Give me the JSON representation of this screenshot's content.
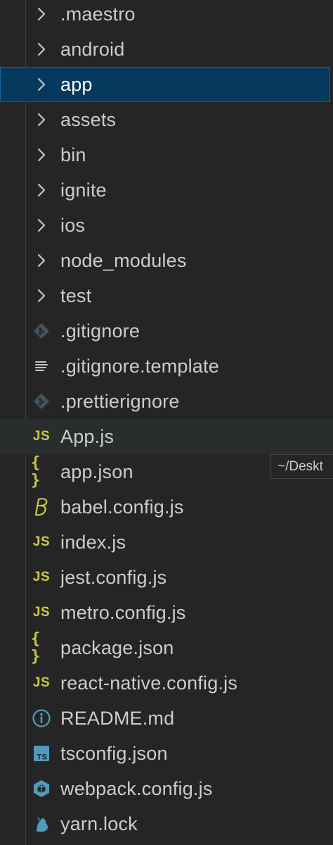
{
  "explorer": {
    "items": [
      {
        "label": ".maestro",
        "kind": "folder",
        "icon": "chevron-right-icon"
      },
      {
        "label": "android",
        "kind": "folder",
        "icon": "chevron-right-icon"
      },
      {
        "label": "app",
        "kind": "folder",
        "icon": "chevron-right-icon",
        "state": "selected"
      },
      {
        "label": "assets",
        "kind": "folder",
        "icon": "chevron-right-icon"
      },
      {
        "label": "bin",
        "kind": "folder",
        "icon": "chevron-right-icon"
      },
      {
        "label": "ignite",
        "kind": "folder",
        "icon": "chevron-right-icon"
      },
      {
        "label": "ios",
        "kind": "folder",
        "icon": "chevron-right-icon"
      },
      {
        "label": "node_modules",
        "kind": "folder",
        "icon": "chevron-right-icon"
      },
      {
        "label": "test",
        "kind": "folder",
        "icon": "chevron-right-icon"
      },
      {
        "label": ".gitignore",
        "kind": "file",
        "icon": "git-file-icon"
      },
      {
        "label": ".gitignore.template",
        "kind": "file",
        "icon": "text-lines-icon"
      },
      {
        "label": ".prettierignore",
        "kind": "file",
        "icon": "git-file-icon"
      },
      {
        "label": "App.js",
        "kind": "file",
        "icon": "javascript-icon",
        "badge": "JS",
        "state": "hovered"
      },
      {
        "label": "app.json",
        "kind": "file",
        "icon": "json-braces-icon",
        "badge": "{ }"
      },
      {
        "label": "babel.config.js",
        "kind": "file",
        "icon": "babel-icon"
      },
      {
        "label": "index.js",
        "kind": "file",
        "icon": "javascript-icon",
        "badge": "JS"
      },
      {
        "label": "jest.config.js",
        "kind": "file",
        "icon": "javascript-icon",
        "badge": "JS"
      },
      {
        "label": "metro.config.js",
        "kind": "file",
        "icon": "javascript-icon",
        "badge": "JS"
      },
      {
        "label": "package.json",
        "kind": "file",
        "icon": "json-braces-icon",
        "badge": "{ }"
      },
      {
        "label": "react-native.config.js",
        "kind": "file",
        "icon": "javascript-icon",
        "badge": "JS"
      },
      {
        "label": "README.md",
        "kind": "file",
        "icon": "info-icon"
      },
      {
        "label": "tsconfig.json",
        "kind": "file",
        "icon": "typescript-icon",
        "badge": "TS"
      },
      {
        "label": "webpack.config.js",
        "kind": "file",
        "icon": "webpack-icon"
      },
      {
        "label": "yarn.lock",
        "kind": "file",
        "icon": "yarn-icon"
      }
    ]
  },
  "tooltip": {
    "text": "~/Deskt"
  },
  "colors": {
    "background": "#252526",
    "selected_background": "#04395e",
    "selected_border": "#0e639c",
    "hover_background": "#2a2d2e",
    "js_yellow": "#cbcb41",
    "git_gray": "#41535b",
    "info_blue": "#519aba",
    "ts_blue": "#519aba",
    "text": "#cccccc"
  }
}
